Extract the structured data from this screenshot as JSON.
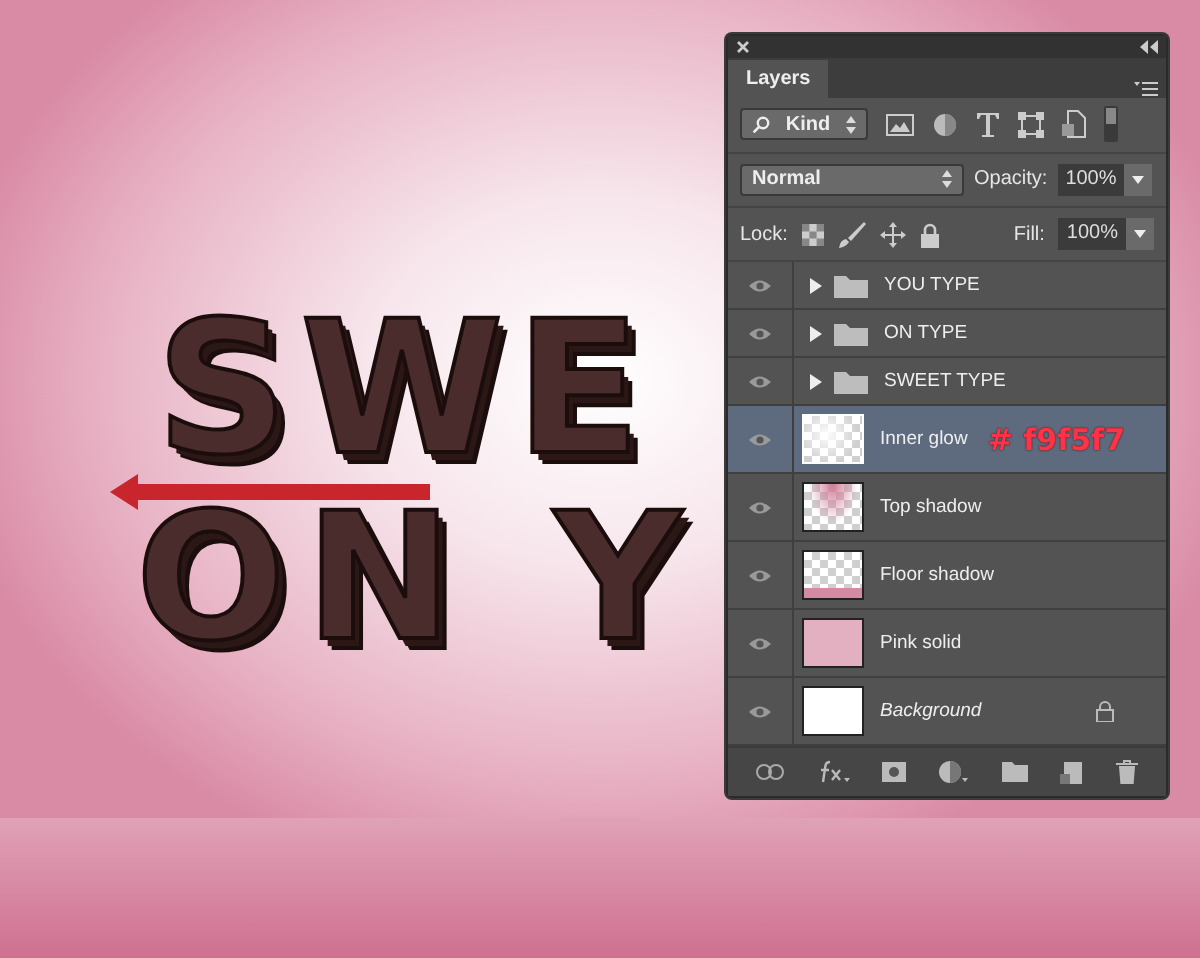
{
  "canvas": {
    "lines": [
      "SWE",
      "ON Y"
    ]
  },
  "panel": {
    "tab": "Layers",
    "filter": {
      "label": "Kind"
    },
    "blend_mode": "Normal",
    "opacity": {
      "label": "Opacity:",
      "value": "100%"
    },
    "lock_label": "Lock:",
    "fill": {
      "label": "Fill:",
      "value": "100%"
    },
    "layers": [
      {
        "kind": "group",
        "name": "YOU TYPE",
        "visible": true,
        "selected": false,
        "expanded": false
      },
      {
        "kind": "group",
        "name": "ON TYPE",
        "visible": true,
        "selected": false,
        "expanded": false
      },
      {
        "kind": "group",
        "name": "SWEET TYPE",
        "visible": true,
        "selected": false,
        "expanded": false
      },
      {
        "kind": "glow",
        "name": "Inner glow",
        "visible": true,
        "selected": true,
        "note": "# f9f5f7"
      },
      {
        "kind": "top",
        "name": "Top shadow",
        "visible": true,
        "selected": false
      },
      {
        "kind": "floor",
        "name": "Floor shadow",
        "visible": true,
        "selected": false
      },
      {
        "kind": "pink",
        "name": "Pink solid",
        "visible": true,
        "selected": false
      },
      {
        "kind": "white",
        "name": "Background",
        "visible": true,
        "selected": false,
        "locked": true
      }
    ]
  }
}
